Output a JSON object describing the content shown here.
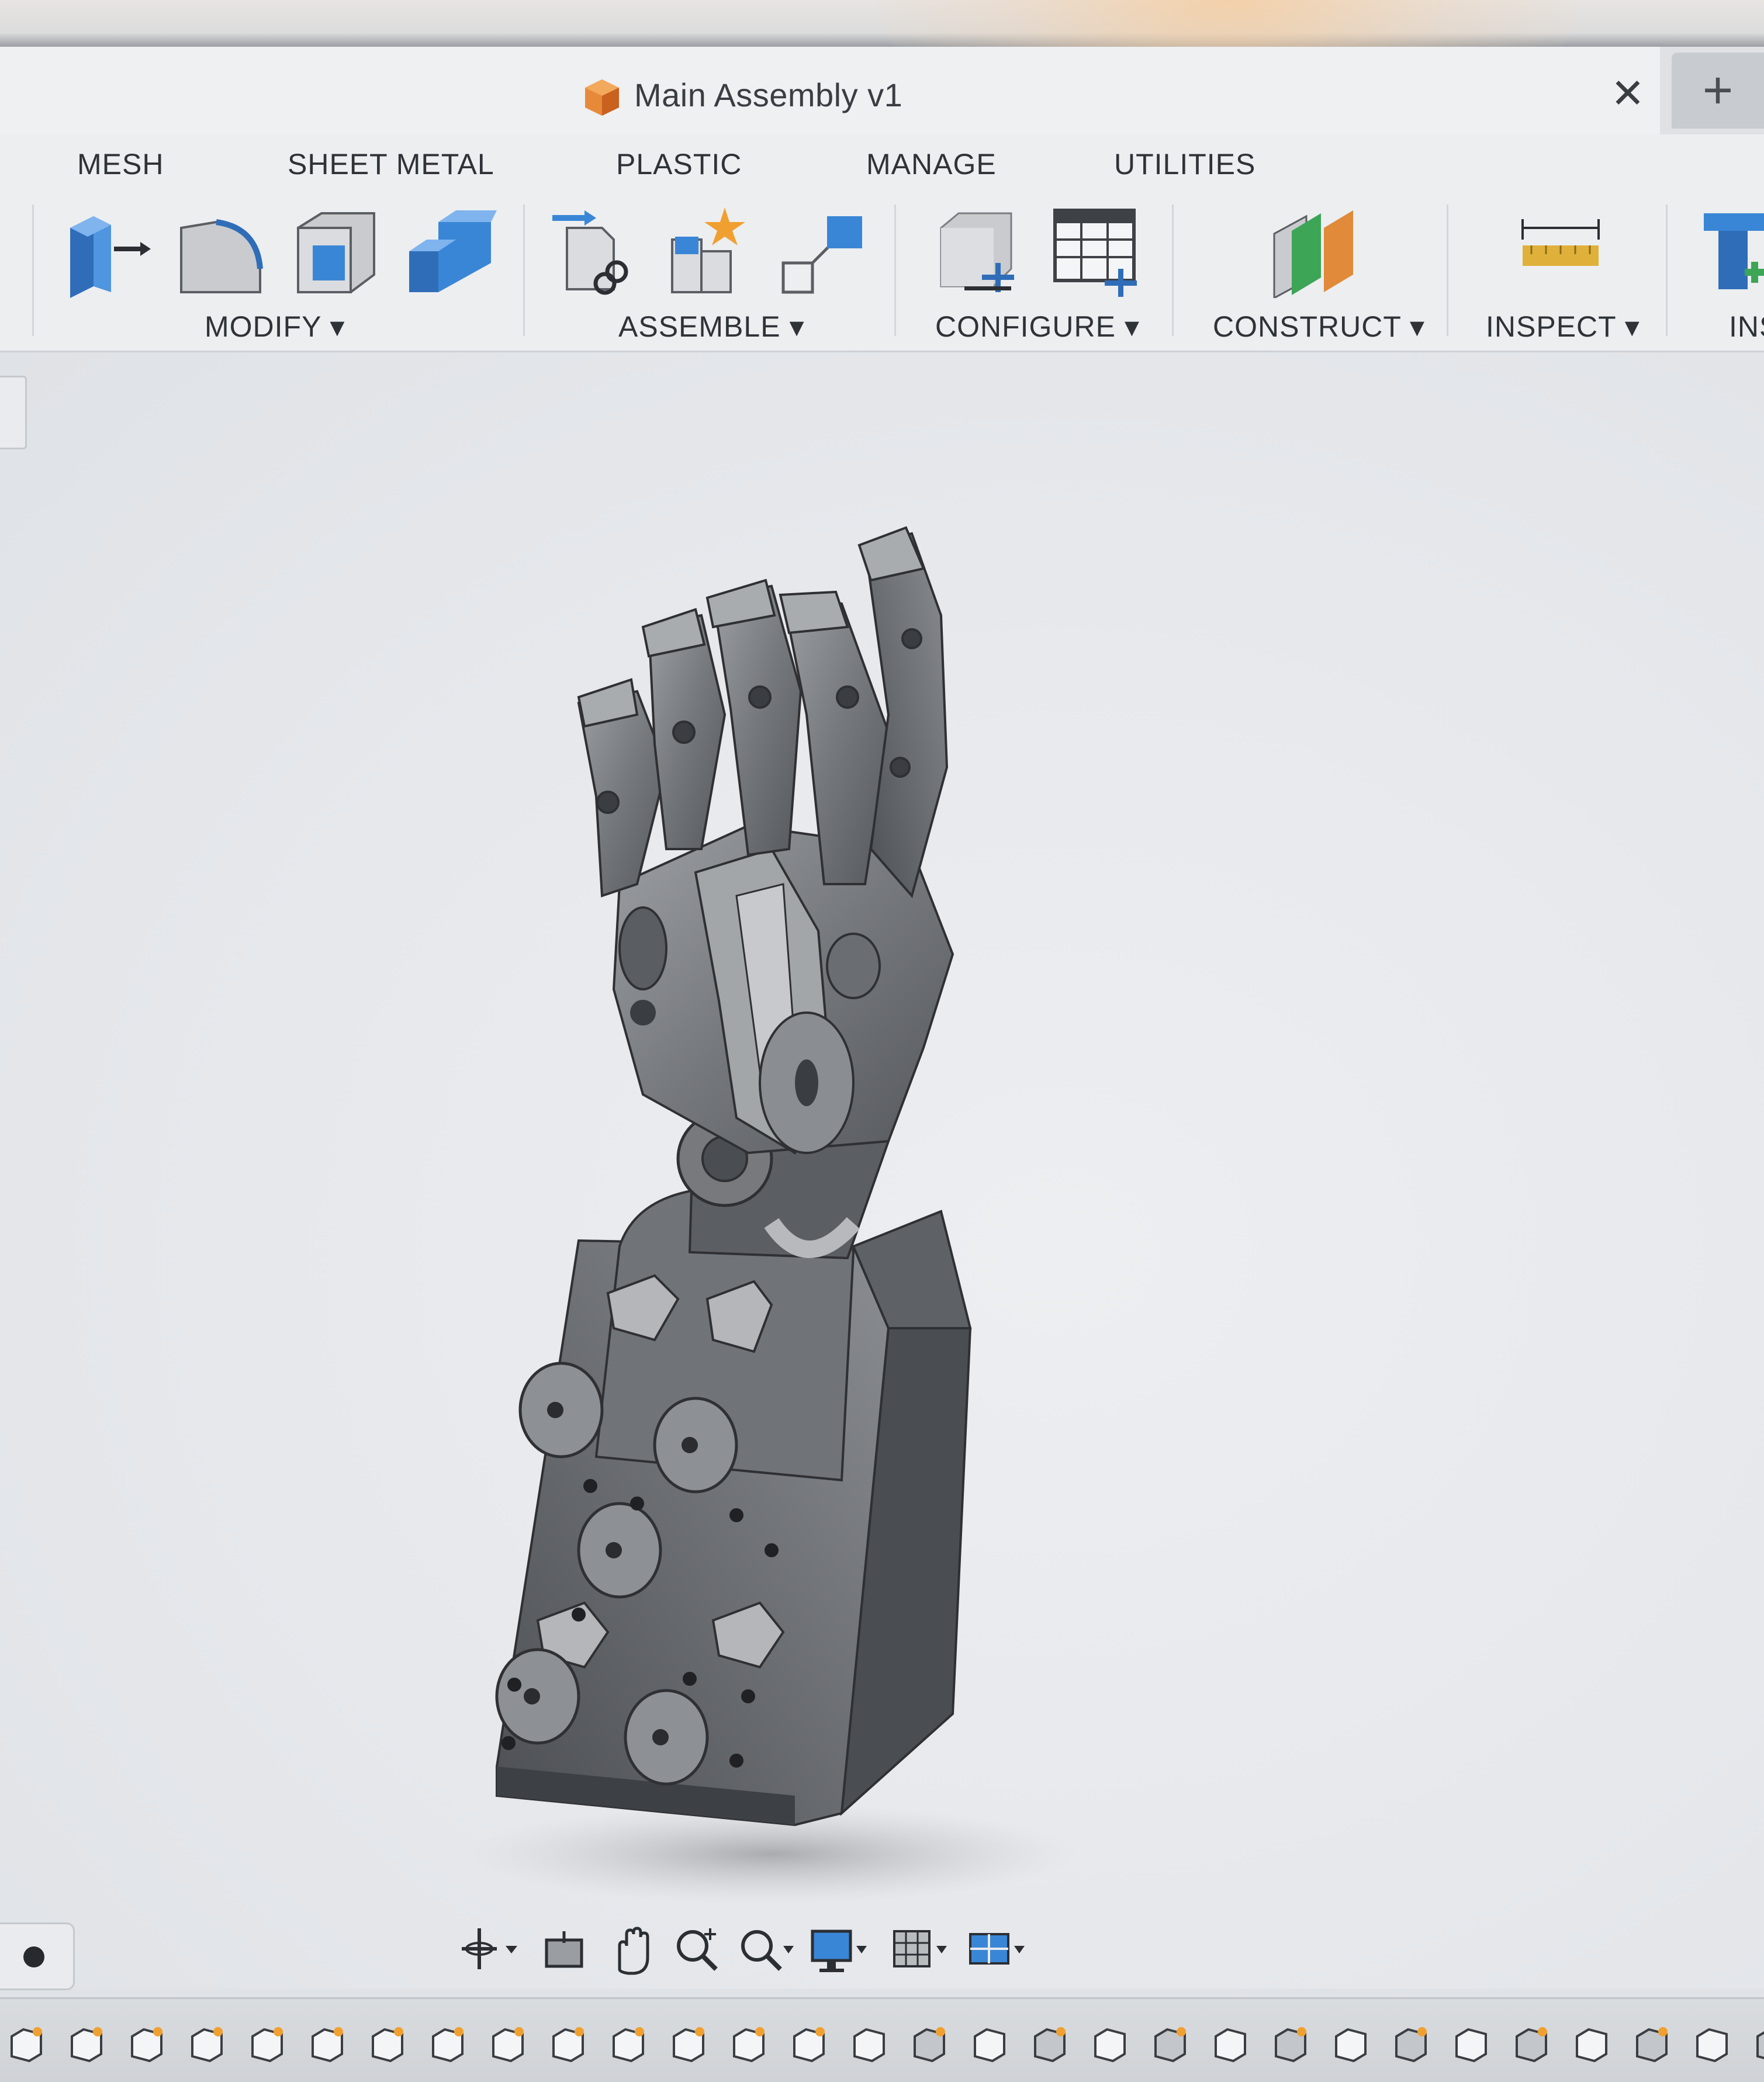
{
  "window": {
    "document_title": "Main Assembly v1",
    "close_glyph": "✕",
    "new_tab_glyph": "+"
  },
  "workspace_tabs": [
    "MESH",
    "SHEET METAL",
    "PLASTIC",
    "MANAGE",
    "UTILITIES"
  ],
  "ribbon": {
    "groups": {
      "modify": "MODIFY ▾",
      "assemble": "ASSEMBLE ▾",
      "configure": "CONFIGURE ▾",
      "construct": "CONSTRUCT ▾",
      "inspect": "INSPECT ▾",
      "insert_partial": "INS"
    },
    "icons": {
      "modify": [
        "press-pull-icon",
        "fillet-icon",
        "shell-icon",
        "combine-icon"
      ],
      "assemble": [
        "new-component-icon",
        "joint-icon",
        "as-built-joint-icon"
      ],
      "configure": [
        "configure-icon",
        "configuration-table-icon"
      ],
      "construct": [
        "offset-plane-icon"
      ],
      "inspect": [
        "measure-icon"
      ],
      "insert": [
        "insert-icon"
      ]
    }
  },
  "viewport": {
    "model": "robotic-hand-assembly"
  },
  "nav_bar": {
    "buttons": [
      "orbit-icon",
      "look-at-icon",
      "pan-icon",
      "zoom-icon",
      "fit-icon",
      "display-settings-icon",
      "grid-settings-icon",
      "viewports-icon"
    ]
  },
  "timeline": {
    "item_icon": "timeline-component-icon"
  },
  "colors": {
    "accent_blue": "#3a86d6",
    "brand_orange": "#e07a2a",
    "construct_green": "#3da556",
    "ruler_yellow": "#e0b13a",
    "model_gray": "#6b6e72"
  }
}
